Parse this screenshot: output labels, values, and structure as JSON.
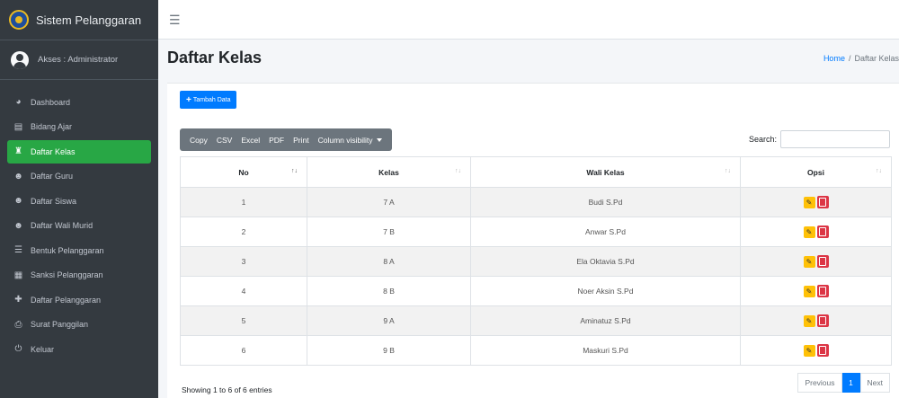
{
  "app": {
    "brand": "Sistem Pelanggaran"
  },
  "user": {
    "label": "Akses : Administrator"
  },
  "sidebar": {
    "items": [
      {
        "label": "Dashboard",
        "icon": "dashboard-icon"
      },
      {
        "label": "Bidang Ajar",
        "icon": "book-icon"
      },
      {
        "label": "Daftar Kelas",
        "icon": "class-icon",
        "active": true
      },
      {
        "label": "Daftar Guru",
        "icon": "users-icon"
      },
      {
        "label": "Daftar Siswa",
        "icon": "users-icon"
      },
      {
        "label": "Daftar Wali Murid",
        "icon": "users-icon"
      },
      {
        "label": "Bentuk Pelanggaran",
        "icon": "list-icon"
      },
      {
        "label": "Sanksi Pelanggaran",
        "icon": "table-icon"
      },
      {
        "label": "Daftar Pelanggaran",
        "icon": "plus-icon"
      },
      {
        "label": "Surat Panggilan",
        "icon": "print-icon"
      },
      {
        "label": "Keluar",
        "icon": "power-icon"
      }
    ]
  },
  "header": {
    "title": "Daftar Kelas",
    "breadcrumb_home": "Home",
    "breadcrumb_sep": "/",
    "breadcrumb_current": "Daftar Kelas"
  },
  "toolbar": {
    "add_label": "Tambah Data",
    "export_buttons": [
      "Copy",
      "CSV",
      "Excel",
      "PDF",
      "Print"
    ],
    "column_visibility": "Column visibility",
    "search_label": "Search:",
    "search_value": ""
  },
  "table": {
    "columns": [
      "No",
      "Kelas",
      "Wali Kelas",
      "Opsi"
    ],
    "rows": [
      {
        "no": "1",
        "kelas": "7 A",
        "wali": "Budi S.Pd"
      },
      {
        "no": "2",
        "kelas": "7 B",
        "wali": "Anwar S.Pd"
      },
      {
        "no": "3",
        "kelas": "8 A",
        "wali": "Ela Oktavia S.Pd"
      },
      {
        "no": "4",
        "kelas": "8 B",
        "wali": "Noer Aksin S.Pd"
      },
      {
        "no": "5",
        "kelas": "9 A",
        "wali": "Aminatuz S.Pd"
      },
      {
        "no": "6",
        "kelas": "9 B",
        "wali": "Maskuri S.Pd"
      }
    ]
  },
  "footer": {
    "info": "Showing 1 to 6 of 6 entries",
    "previous": "Previous",
    "page": "1",
    "next": "Next"
  },
  "colors": {
    "sidebar_bg": "#343a40",
    "active_green": "#28a745",
    "primary_blue": "#007bff",
    "edit_yellow": "#ffc107",
    "delete_red": "#dc3545"
  }
}
